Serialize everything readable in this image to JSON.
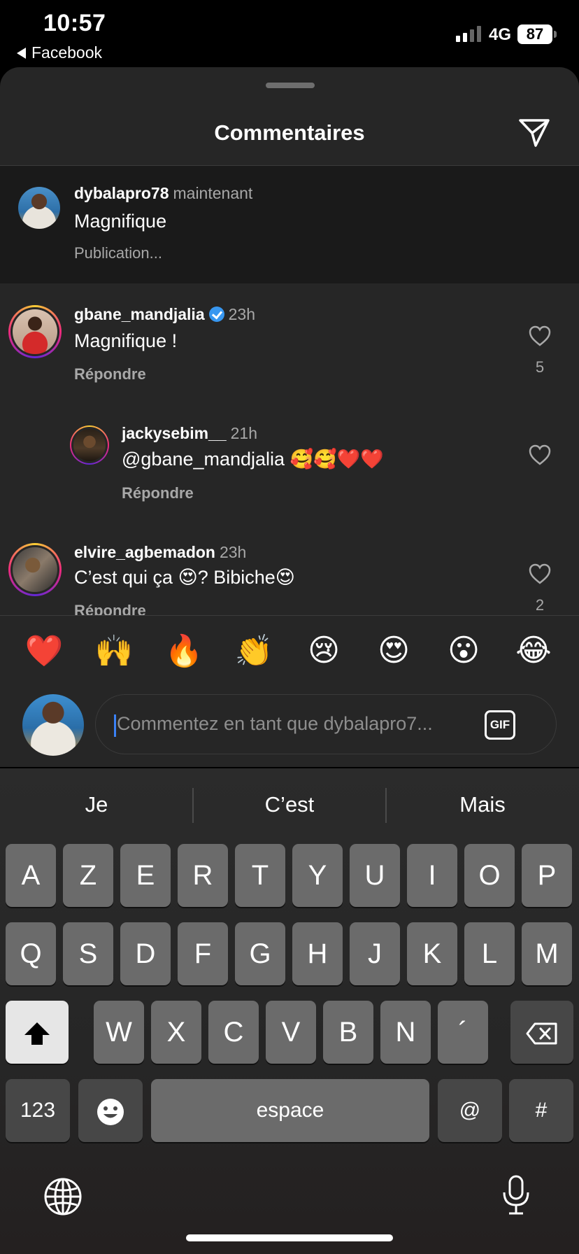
{
  "status_bar": {
    "time": "10:57",
    "back_app": "Facebook",
    "network": "4G",
    "battery": "87"
  },
  "sheet": {
    "title": "Commentaires",
    "share_icon": "paper-plane-icon"
  },
  "pending_comment": {
    "username": "dybalapro78",
    "time": "maintenant",
    "text": "Magnifique",
    "status": "Publication..."
  },
  "comments": [
    {
      "username": "gbane_mandjalia",
      "verified": true,
      "time": "23h",
      "text": "Magnifique !",
      "reply_label": "Répondre",
      "likes": "5"
    },
    {
      "username": "jackysebim__",
      "time": "21h",
      "text": "@gbane_mandjalia 🥰🥰❤️❤️",
      "reply_label": "Répondre"
    },
    {
      "username": "elvire_agbemadon",
      "time": "23h",
      "text": "C’est qui ça 😍? Bibiche😍",
      "reply_label": "Répondre",
      "likes": "2"
    }
  ],
  "quick_emojis": [
    "❤️",
    "🙌",
    "🔥",
    "👏",
    "😢",
    "😍",
    "😮",
    "😂"
  ],
  "composer": {
    "placeholder": "Commentez en tant que dybalapro7...",
    "gif_label": "GIF"
  },
  "keyboard": {
    "suggestions": [
      "Je",
      "C’est",
      "Mais"
    ],
    "row1": [
      "A",
      "Z",
      "E",
      "R",
      "T",
      "Y",
      "U",
      "I",
      "O",
      "P"
    ],
    "row2": [
      "Q",
      "S",
      "D",
      "F",
      "G",
      "H",
      "J",
      "K",
      "L",
      "M"
    ],
    "row3": [
      "W",
      "X",
      "C",
      "V",
      "B",
      "N",
      "´"
    ],
    "numbers_label": "123",
    "space_label": "espace",
    "at_label": "@",
    "hash_label": "#"
  }
}
